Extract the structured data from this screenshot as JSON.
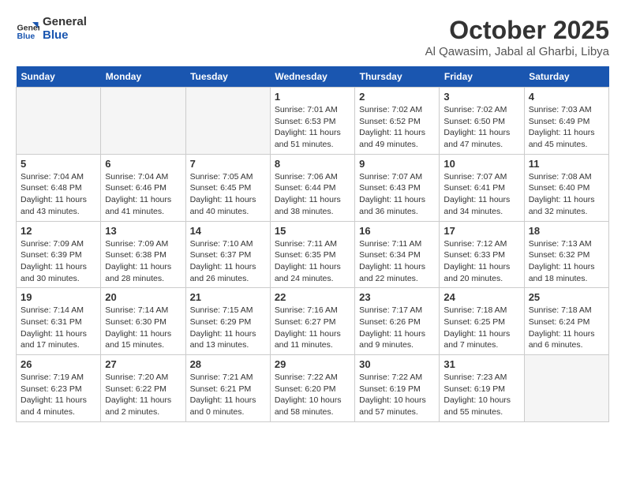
{
  "header": {
    "logo_line1": "General",
    "logo_line2": "Blue",
    "month": "October 2025",
    "location": "Al Qawasim, Jabal al Gharbi, Libya"
  },
  "days_of_week": [
    "Sunday",
    "Monday",
    "Tuesday",
    "Wednesday",
    "Thursday",
    "Friday",
    "Saturday"
  ],
  "weeks": [
    [
      {
        "day": null,
        "info": null
      },
      {
        "day": null,
        "info": null
      },
      {
        "day": null,
        "info": null
      },
      {
        "day": "1",
        "sunrise": "Sunrise: 7:01 AM",
        "sunset": "Sunset: 6:53 PM",
        "daylight": "Daylight: 11 hours and 51 minutes."
      },
      {
        "day": "2",
        "sunrise": "Sunrise: 7:02 AM",
        "sunset": "Sunset: 6:52 PM",
        "daylight": "Daylight: 11 hours and 49 minutes."
      },
      {
        "day": "3",
        "sunrise": "Sunrise: 7:02 AM",
        "sunset": "Sunset: 6:50 PM",
        "daylight": "Daylight: 11 hours and 47 minutes."
      },
      {
        "day": "4",
        "sunrise": "Sunrise: 7:03 AM",
        "sunset": "Sunset: 6:49 PM",
        "daylight": "Daylight: 11 hours and 45 minutes."
      }
    ],
    [
      {
        "day": "5",
        "sunrise": "Sunrise: 7:04 AM",
        "sunset": "Sunset: 6:48 PM",
        "daylight": "Daylight: 11 hours and 43 minutes."
      },
      {
        "day": "6",
        "sunrise": "Sunrise: 7:04 AM",
        "sunset": "Sunset: 6:46 PM",
        "daylight": "Daylight: 11 hours and 41 minutes."
      },
      {
        "day": "7",
        "sunrise": "Sunrise: 7:05 AM",
        "sunset": "Sunset: 6:45 PM",
        "daylight": "Daylight: 11 hours and 40 minutes."
      },
      {
        "day": "8",
        "sunrise": "Sunrise: 7:06 AM",
        "sunset": "Sunset: 6:44 PM",
        "daylight": "Daylight: 11 hours and 38 minutes."
      },
      {
        "day": "9",
        "sunrise": "Sunrise: 7:07 AM",
        "sunset": "Sunset: 6:43 PM",
        "daylight": "Daylight: 11 hours and 36 minutes."
      },
      {
        "day": "10",
        "sunrise": "Sunrise: 7:07 AM",
        "sunset": "Sunset: 6:41 PM",
        "daylight": "Daylight: 11 hours and 34 minutes."
      },
      {
        "day": "11",
        "sunrise": "Sunrise: 7:08 AM",
        "sunset": "Sunset: 6:40 PM",
        "daylight": "Daylight: 11 hours and 32 minutes."
      }
    ],
    [
      {
        "day": "12",
        "sunrise": "Sunrise: 7:09 AM",
        "sunset": "Sunset: 6:39 PM",
        "daylight": "Daylight: 11 hours and 30 minutes."
      },
      {
        "day": "13",
        "sunrise": "Sunrise: 7:09 AM",
        "sunset": "Sunset: 6:38 PM",
        "daylight": "Daylight: 11 hours and 28 minutes."
      },
      {
        "day": "14",
        "sunrise": "Sunrise: 7:10 AM",
        "sunset": "Sunset: 6:37 PM",
        "daylight": "Daylight: 11 hours and 26 minutes."
      },
      {
        "day": "15",
        "sunrise": "Sunrise: 7:11 AM",
        "sunset": "Sunset: 6:35 PM",
        "daylight": "Daylight: 11 hours and 24 minutes."
      },
      {
        "day": "16",
        "sunrise": "Sunrise: 7:11 AM",
        "sunset": "Sunset: 6:34 PM",
        "daylight": "Daylight: 11 hours and 22 minutes."
      },
      {
        "day": "17",
        "sunrise": "Sunrise: 7:12 AM",
        "sunset": "Sunset: 6:33 PM",
        "daylight": "Daylight: 11 hours and 20 minutes."
      },
      {
        "day": "18",
        "sunrise": "Sunrise: 7:13 AM",
        "sunset": "Sunset: 6:32 PM",
        "daylight": "Daylight: 11 hours and 18 minutes."
      }
    ],
    [
      {
        "day": "19",
        "sunrise": "Sunrise: 7:14 AM",
        "sunset": "Sunset: 6:31 PM",
        "daylight": "Daylight: 11 hours and 17 minutes."
      },
      {
        "day": "20",
        "sunrise": "Sunrise: 7:14 AM",
        "sunset": "Sunset: 6:30 PM",
        "daylight": "Daylight: 11 hours and 15 minutes."
      },
      {
        "day": "21",
        "sunrise": "Sunrise: 7:15 AM",
        "sunset": "Sunset: 6:29 PM",
        "daylight": "Daylight: 11 hours and 13 minutes."
      },
      {
        "day": "22",
        "sunrise": "Sunrise: 7:16 AM",
        "sunset": "Sunset: 6:27 PM",
        "daylight": "Daylight: 11 hours and 11 minutes."
      },
      {
        "day": "23",
        "sunrise": "Sunrise: 7:17 AM",
        "sunset": "Sunset: 6:26 PM",
        "daylight": "Daylight: 11 hours and 9 minutes."
      },
      {
        "day": "24",
        "sunrise": "Sunrise: 7:18 AM",
        "sunset": "Sunset: 6:25 PM",
        "daylight": "Daylight: 11 hours and 7 minutes."
      },
      {
        "day": "25",
        "sunrise": "Sunrise: 7:18 AM",
        "sunset": "Sunset: 6:24 PM",
        "daylight": "Daylight: 11 hours and 6 minutes."
      }
    ],
    [
      {
        "day": "26",
        "sunrise": "Sunrise: 7:19 AM",
        "sunset": "Sunset: 6:23 PM",
        "daylight": "Daylight: 11 hours and 4 minutes."
      },
      {
        "day": "27",
        "sunrise": "Sunrise: 7:20 AM",
        "sunset": "Sunset: 6:22 PM",
        "daylight": "Daylight: 11 hours and 2 minutes."
      },
      {
        "day": "28",
        "sunrise": "Sunrise: 7:21 AM",
        "sunset": "Sunset: 6:21 PM",
        "daylight": "Daylight: 11 hours and 0 minutes."
      },
      {
        "day": "29",
        "sunrise": "Sunrise: 7:22 AM",
        "sunset": "Sunset: 6:20 PM",
        "daylight": "Daylight: 10 hours and 58 minutes."
      },
      {
        "day": "30",
        "sunrise": "Sunrise: 7:22 AM",
        "sunset": "Sunset: 6:19 PM",
        "daylight": "Daylight: 10 hours and 57 minutes."
      },
      {
        "day": "31",
        "sunrise": "Sunrise: 7:23 AM",
        "sunset": "Sunset: 6:19 PM",
        "daylight": "Daylight: 10 hours and 55 minutes."
      },
      {
        "day": null,
        "info": null
      }
    ]
  ]
}
